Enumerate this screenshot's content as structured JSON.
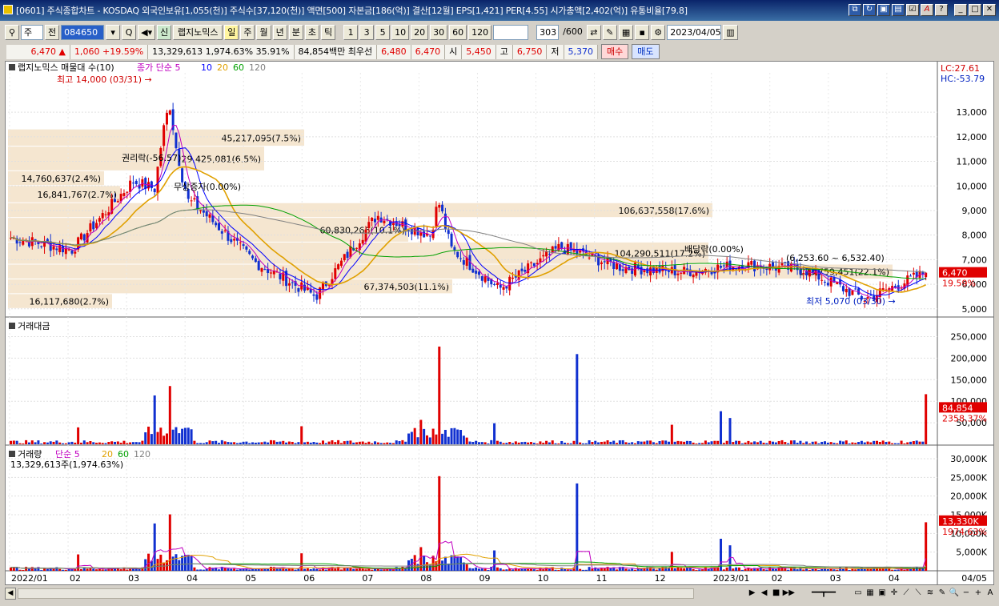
{
  "window": {
    "title": "[0601] 주식종합차트 - KOSDAQ 외국인보유[1,055(천)] 주식수[37,120(천)] 액면[500] 자본금[186(억)] 결산[12월] EPS[1,421] PER[4.55] 시가총액[2,402(억)] 유통비율[79.8]"
  },
  "toolbar": {
    "market": "주",
    "all_label": "전",
    "code": "084650",
    "stock_name": "랩지노믹스",
    "new_badge": "신",
    "periods": [
      "일",
      "주",
      "월",
      "년",
      "분",
      "초",
      "틱"
    ],
    "active_period": "일",
    "intervals": [
      "1",
      "3",
      "5",
      "10",
      "20",
      "30",
      "60",
      "120"
    ],
    "count": "303",
    "max_count": "/600",
    "date": "2023/04/05"
  },
  "quote": {
    "price": "6,470",
    "change": "1,060",
    "change_pct": "+19.59%",
    "volume": "13,329,613",
    "volume_ratio": "1,974.63%",
    "turnover_pct": "35.91%",
    "amount": "84,854백만",
    "pref_label": "최우선",
    "ask": "6,480",
    "bid": "6,470",
    "open_label": "시",
    "open": "5,450",
    "high_label": "고",
    "high": "6,750",
    "low_label": "저",
    "low": "5,370",
    "buy_label": "매수",
    "sell_label": "매도"
  },
  "colors": {
    "up": "#e00000",
    "down": "#1030d0",
    "ma5": "#c000c0",
    "ma10": "#0000ff",
    "ma20": "#e0a000",
    "ma60": "#00a000",
    "ma120": "#808080",
    "band": "#f5e6d0"
  },
  "panes": {
    "price": {
      "title": "랩지노믹스 매물대 수(10)",
      "ma_label": "종가 단순 5",
      "ma_periods": [
        "10",
        "20",
        "60",
        "120"
      ],
      "lc": "LC:27.61",
      "hc": "HC:-53.79",
      "high_note": "최고 14,000 (03/31)",
      "low_note": "최저 5,070 (03/30)",
      "last_price": "6,470",
      "last_pct": "19.59%",
      "y_ticks": [
        "13,000",
        "12,000",
        "11,000",
        "10,000",
        "9,000",
        "8,000",
        "7,000",
        "6,000",
        "5,000"
      ],
      "bands": [
        "16,117,680(2.7%)",
        "67,374,503(11.1%)",
        "133,759,451(22.1%)",
        "104,290,511(17.2%)",
        "106,637,558(17.6%)",
        "60,830,266(10.1%)",
        "16,841,767(2.7%)",
        "14,760,637(2.4%)",
        "29,425,081(6.5%)",
        "45,217,095(7.5%)"
      ],
      "events": [
        "권리락(-56.57)",
        "무상증자(0.00%)",
        "배당락(0.00%)"
      ],
      "range_note": "(6,253.60 ~ 6,532.40)"
    },
    "amount": {
      "title": "거래대금",
      "y_ticks": [
        "250,000",
        "200,000",
        "150,000",
        "100,000",
        "50,000"
      ],
      "last_value": "84,854",
      "last_pct": "2358.37%"
    },
    "volume": {
      "title": "거래량",
      "ma_label": "단순 5",
      "ma_periods": [
        "20",
        "60",
        "120"
      ],
      "subtitle": "13,329,613주(1,974.63%)",
      "y_ticks": [
        "30,000K",
        "25,000K",
        "20,000K",
        "15,000K",
        "10,000K",
        "5,000K"
      ],
      "last_value": "13,330K",
      "last_pct": "1974.63%"
    }
  },
  "x_axis": {
    "labels": [
      "2022/01",
      "02",
      "03",
      "04",
      "05",
      "06",
      "07",
      "08",
      "09",
      "10",
      "11",
      "12",
      "2023/01",
      "02",
      "03",
      "04"
    ],
    "right_label": "04/05"
  },
  "chart_data": {
    "type": "candlestick",
    "title": "랩지노믹스",
    "ylim": [
      4700,
      14600
    ],
    "monthly_close": [
      {
        "month": "2022/01",
        "value": 7900
      },
      {
        "month": "02",
        "value": 7400
      },
      {
        "month": "03",
        "value": 10200
      },
      {
        "month": "04",
        "value": 9300
      },
      {
        "month": "05",
        "value": 6900
      },
      {
        "month": "06",
        "value": 5500
      },
      {
        "month": "07",
        "value": 8800
      },
      {
        "month": "08",
        "value": 7900
      },
      {
        "month": "09",
        "value": 5800
      },
      {
        "month": "10",
        "value": 7500
      },
      {
        "month": "11",
        "value": 6700
      },
      {
        "month": "12",
        "value": 6500
      },
      {
        "month": "2023/01",
        "value": 6800
      },
      {
        "month": "02",
        "value": 6600
      },
      {
        "month": "03",
        "value": 5400
      },
      {
        "month": "04",
        "value": 6470
      }
    ],
    "high": 14000,
    "low": 5070,
    "last": 6470
  }
}
